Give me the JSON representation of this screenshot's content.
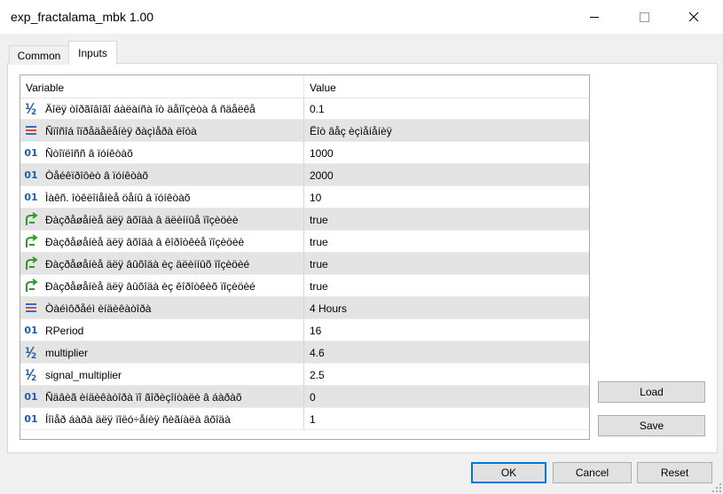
{
  "window": {
    "title": "exp_fractalama_mbk 1.00"
  },
  "tabs": [
    {
      "label": "Common"
    },
    {
      "label": "Inputs"
    }
  ],
  "table": {
    "columns": [
      "Variable",
      "Value"
    ],
    "rows": [
      {
        "icon": "double-type-icon",
        "variable": "Äîëÿ òîðãîâîãî áàëàíñà îò äåïîçèòà â ñäåëêå",
        "value": "0.1"
      },
      {
        "icon": "enum-type-icon",
        "variable": "Ñïîñîá îïðåäåëåíèÿ ðàçìåðà ëîòà",
        "value": "Ëîò âåç èçìåíåíèÿ"
      },
      {
        "icon": "integer-type-icon",
        "variable": "Ñòîïëîññ â ïóíêòàõ",
        "value": "1000"
      },
      {
        "icon": "integer-type-icon",
        "variable": "Òåéêïðîôèò â ïóíêòàõ",
        "value": "2000"
      },
      {
        "icon": "integer-type-icon",
        "variable": "Ìàêñ. îòêëîíåíèå öåíû â ïóíêòàõ",
        "value": "10"
      },
      {
        "icon": "bool-type-icon",
        "variable": "Ðàçðåøåíèå äëÿ âõîäà â äëèííûå ïîçèöèè",
        "value": "true"
      },
      {
        "icon": "bool-type-icon",
        "variable": "Ðàçðåøåíèå äëÿ âõîäà â êîðîòêèå ïîçèöèè",
        "value": "true"
      },
      {
        "icon": "bool-type-icon",
        "variable": "Ðàçðåøåíèå äëÿ âûõîäà èç äëèííûõ ïîçèöèé",
        "value": "true"
      },
      {
        "icon": "bool-type-icon",
        "variable": "Ðàçðåøåíèå äëÿ âûõîäà èç êîðîòêèõ ïîçèöèé",
        "value": "true"
      },
      {
        "icon": "enum-type-icon",
        "variable": "Òàéìôðåéì èíäèêàòîðà",
        "value": "4 Hours"
      },
      {
        "icon": "integer-type-icon",
        "variable": "RPeriod",
        "value": "16"
      },
      {
        "icon": "double-type-icon",
        "variable": "multiplier",
        "value": "4.6"
      },
      {
        "icon": "double-type-icon",
        "variable": "signal_multiplier",
        "value": "2.5"
      },
      {
        "icon": "integer-type-icon",
        "variable": "Ñäâèã èíäèêàòîðà ïî ãîðèçîíòàëè â áàðàõ",
        "value": "0"
      },
      {
        "icon": "integer-type-icon",
        "variable": "Íîìåð áàðà äëÿ ïîëó÷åíèÿ ñèãíàëà âõîäà",
        "value": "1"
      }
    ]
  },
  "side_buttons": {
    "load": "Load",
    "save": "Save"
  },
  "footer_buttons": {
    "ok": "OK",
    "cancel": "Cancel",
    "reset": "Reset"
  },
  "colors": {
    "accent": "#0078d7",
    "row_alt": "#e4e4e4",
    "int_icon": "#1f5fa8",
    "bool_icon": "#2e9a2e"
  }
}
